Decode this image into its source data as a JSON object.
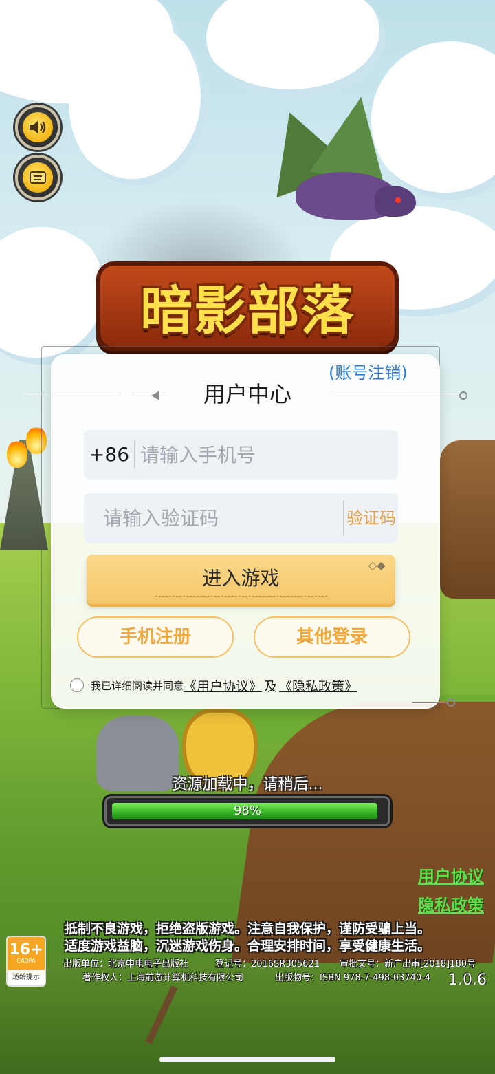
{
  "game": {
    "logo_text": "暗影部落"
  },
  "left_buttons": {
    "sound_icon": "speaker-icon",
    "notice_icon": "scroll-icon"
  },
  "login": {
    "title": "用户中心",
    "cancel_account": "(账号注销)",
    "country_code": "+86",
    "phone_placeholder": "请输入手机号",
    "code_placeholder": "请输入验证码",
    "code_button": "验证码",
    "enter_button": "进入游戏",
    "register_button": "手机注册",
    "other_login_button": "其他登录",
    "agree_prefix": "我已详细阅读并同意",
    "user_agreement": "《用户协议》",
    "and": "及",
    "privacy_policy": "《隐私政策》"
  },
  "loading": {
    "text": "资源加载中，请稍后...",
    "percent_label": "98%",
    "progress": 0.98
  },
  "side_links": {
    "user_agreement": "用户协议",
    "privacy_policy": "隐私政策"
  },
  "notice": {
    "line1": "抵制不良游戏，拒绝盗版游戏。注意自我保护，谨防受骗上当。",
    "line2": "适度游戏益脑，沉迷游戏伤身。合理安排时间，享受健康生活。",
    "publisher": "出版单位：北京中电电子出版社",
    "registration": "登记号：2016SR305621",
    "approval": "审批文号：新广出审[2018]180号",
    "copyright": "著作权人：上海前游计算机科技有限公司",
    "isbn": "出版物号：ISBN 978-7-498-03740-4",
    "version": "1.0.6"
  },
  "age_rating": {
    "age": "16+",
    "org": "CADPA",
    "label": "适龄提示"
  },
  "colors": {
    "accent_gold": "#f5c66a",
    "link_blue": "#2e7ad1",
    "link_green": "#5fe04a",
    "progress_green": "#33b025"
  }
}
